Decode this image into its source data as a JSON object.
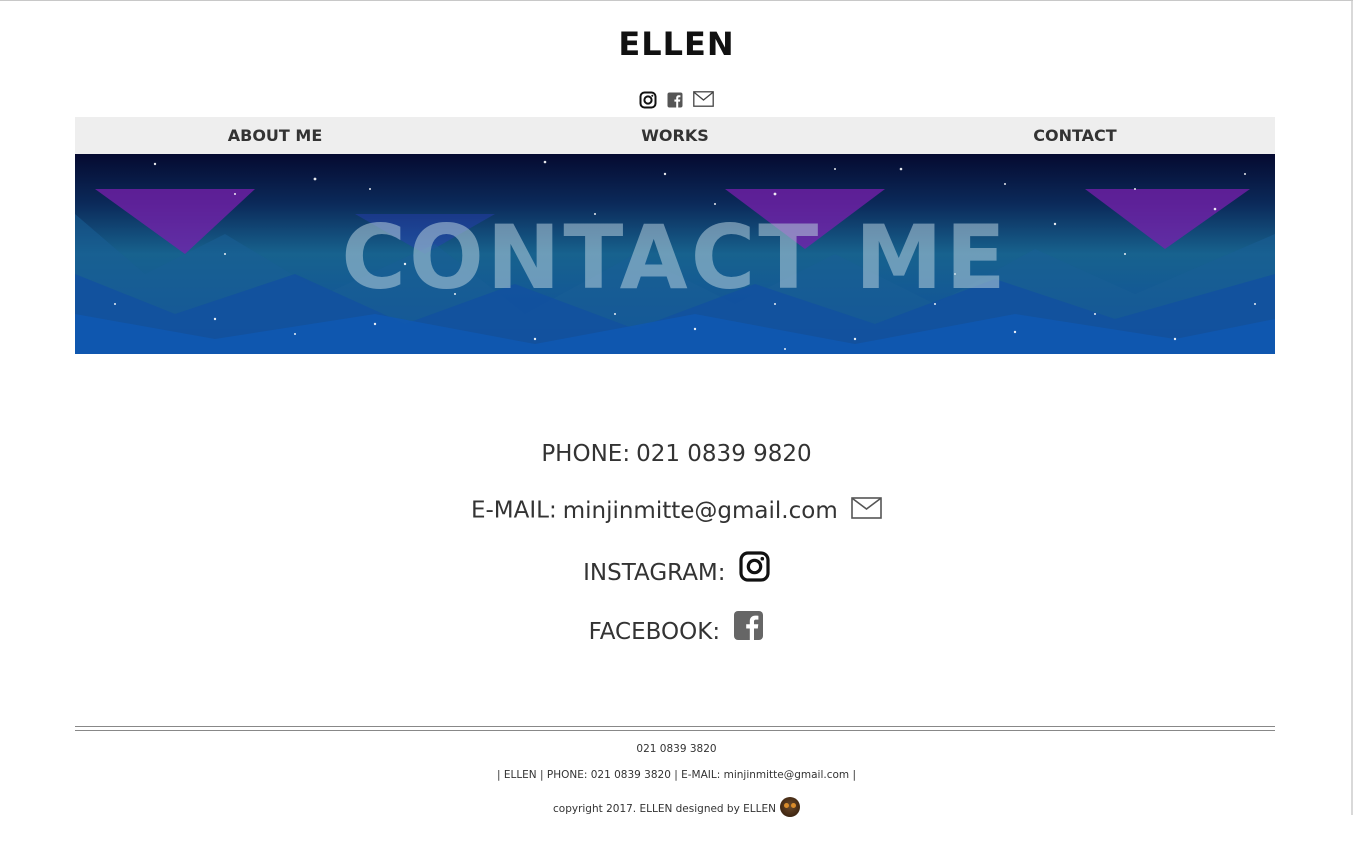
{
  "site": {
    "title": "ELLEN"
  },
  "header_icons": [
    "instagram-icon",
    "facebook-icon",
    "mail-icon"
  ],
  "nav": {
    "items": [
      {
        "label": "ABOUT ME"
      },
      {
        "label": "WORKS"
      },
      {
        "label": "CONTACT"
      }
    ]
  },
  "banner": {
    "title": "CONTACT ME"
  },
  "contact": {
    "phone_label": "PHONE:",
    "phone_value": "021 0839 9820",
    "email_label": "E-MAIL:",
    "email_value": "minjinmitte@gmail.com",
    "instagram_label": "INSTAGRAM:",
    "facebook_label": "FACEBOOK:"
  },
  "footer": {
    "phone": "021 0839 3820",
    "info": "| ELLEN | PHONE: 021 0839 3820 | E-MAIL: minjinmitte@gmail.com |",
    "copyright": "copyright 2017. ELLEN designed by ELLEN"
  },
  "colors": {
    "nav_bg": "#eeeeee",
    "banner_top": "#0a0f3a",
    "banner_bottom": "#1458a8",
    "text": "#333333"
  }
}
